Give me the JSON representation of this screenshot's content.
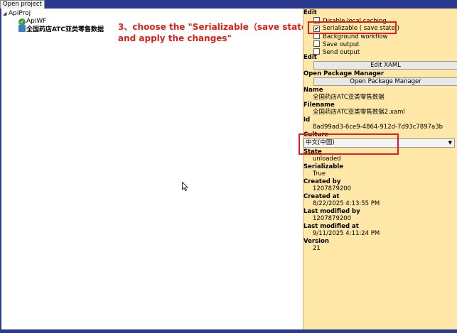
{
  "tab": {
    "label": "Open project"
  },
  "tree": {
    "root": "ApiProj",
    "items": [
      {
        "label": "ApiWF"
      },
      {
        "label": "全国药店ATC亚类零售数据"
      }
    ]
  },
  "annotation": {
    "line1": "3、choose the \"Serializable（save state)",
    "line2": "and apply the changes\""
  },
  "panel": {
    "edit_header": "Edit",
    "options": [
      {
        "label": "Disable local caching",
        "checked": false
      },
      {
        "label": "Serializable ( save state )",
        "checked": true
      },
      {
        "label": "Background workflow",
        "checked": false
      },
      {
        "label": "Save output",
        "checked": false
      },
      {
        "label": "Send output",
        "checked": false
      }
    ],
    "edit2_header": "Edit",
    "edit_xaml_button": "Edit XAML",
    "opm_header": "Open Package Manager",
    "opm_button": "Open Package Manager",
    "name_label": "Name",
    "name_value": "全国药店ATC亚类零售数据",
    "filename_label": "Filename",
    "filename_value": "全国药店ATC亚类零售数据2.xaml",
    "id_label": "Id",
    "id_value": "8ad99ad3-6ce9-4864-912d-7d93c7897a3b",
    "culture_label": "Culture",
    "culture_value": "中文(中国)",
    "state_label": "State",
    "state_value": "unloaded",
    "serializable_label": "Serializable",
    "serializable_value": "True",
    "created_by_label": "Created by",
    "created_by_value": "1207879200",
    "created_at_label": "Created at",
    "created_at_value": "8/22/2025 4:13:55 PM",
    "modified_by_label": "Last modified by",
    "modified_by_value": "1207879200",
    "modified_at_label": "Last modified at",
    "modified_at_value": "9/11/2025 4:11:24 PM",
    "version_label": "Version",
    "version_value": "21"
  },
  "colors": {
    "panel_bg": "#ffe7a8",
    "frame": "#2b3a8e",
    "annotation": "#e0201a",
    "highlight": "#e02020"
  }
}
